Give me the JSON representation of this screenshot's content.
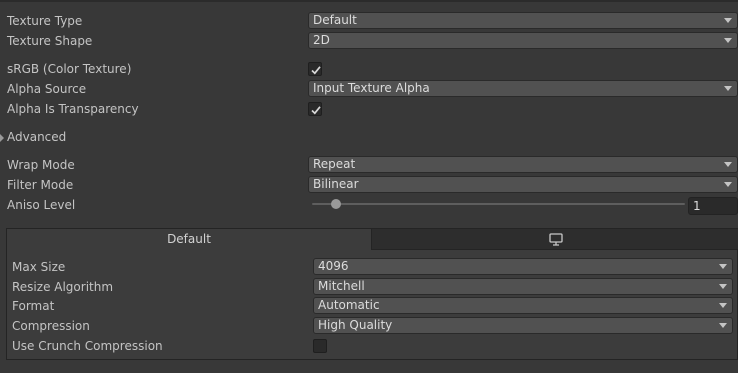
{
  "texture": {
    "type": {
      "label": "Texture Type",
      "value": "Default"
    },
    "shape": {
      "label": "Texture Shape",
      "value": "2D"
    },
    "srgb": {
      "label": "sRGB (Color Texture)",
      "checked": true
    },
    "alpha_source": {
      "label": "Alpha Source",
      "value": "Input Texture Alpha"
    },
    "alpha_transparency": {
      "label": "Alpha Is Transparency",
      "checked": true
    },
    "advanced": {
      "label": "Advanced",
      "expanded": false
    },
    "wrap_mode": {
      "label": "Wrap Mode",
      "value": "Repeat"
    },
    "filter_mode": {
      "label": "Filter Mode",
      "value": "Bilinear"
    },
    "aniso": {
      "label": "Aniso Level",
      "value": "1"
    }
  },
  "platform": {
    "tabs": [
      {
        "label": "Default",
        "active": true
      },
      {
        "label": "",
        "icon": "monitor-icon",
        "active": false
      }
    ],
    "max_size": {
      "label": "Max Size",
      "value": "4096"
    },
    "resize": {
      "label": "Resize Algorithm",
      "value": "Mitchell"
    },
    "format": {
      "label": "Format",
      "value": "Automatic"
    },
    "compression": {
      "label": "Compression",
      "value": "High Quality"
    },
    "crunch": {
      "label": "Use Crunch Compression",
      "checked": false
    }
  }
}
